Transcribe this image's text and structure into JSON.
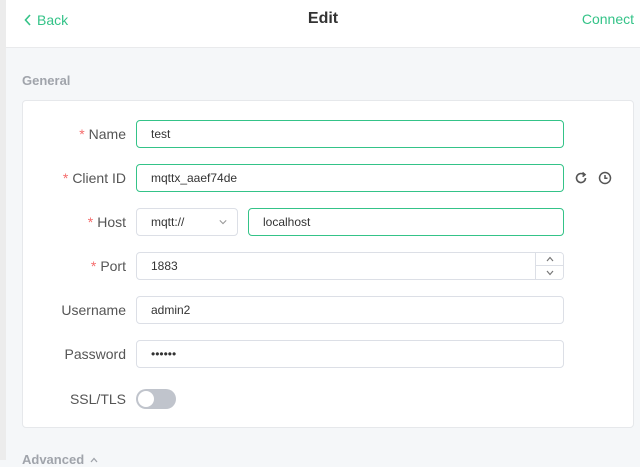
{
  "header": {
    "back_label": "Back",
    "title": "Edit",
    "connect_label": "Connect"
  },
  "general": {
    "section_title": "General",
    "required_mark": "*",
    "name": {
      "label": "Name",
      "value": "test"
    },
    "client_id": {
      "label": "Client ID",
      "value": "mqttx_aaef74de"
    },
    "host": {
      "label": "Host",
      "protocol": "mqtt://",
      "value": "localhost"
    },
    "port": {
      "label": "Port",
      "value": "1883"
    },
    "username": {
      "label": "Username",
      "value": "admin2"
    },
    "password": {
      "label": "Password",
      "value": "••••••"
    },
    "ssl": {
      "label": "SSL/TLS",
      "enabled": false
    }
  },
  "advanced": {
    "section_title": "Advanced"
  },
  "colors": {
    "accent": "#34c388",
    "required": "#f56c6c",
    "toggle_off": "#c0c4cc"
  },
  "icons": [
    "chevron-left-icon",
    "refresh-icon",
    "clock-icon",
    "chevron-down-icon",
    "chevron-up-icon"
  ]
}
